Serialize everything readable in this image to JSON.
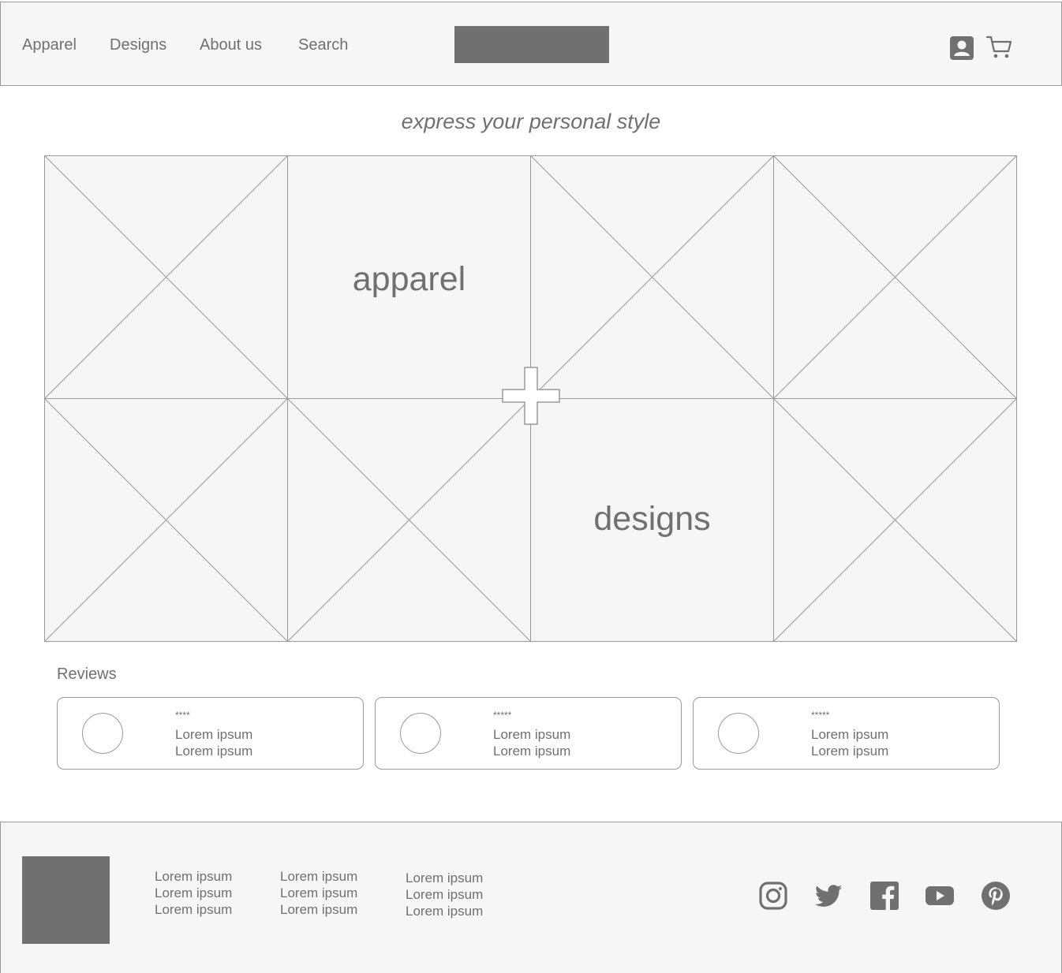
{
  "header": {
    "nav": [
      "Apparel",
      "Designs",
      "About us",
      "Search"
    ],
    "logo": "logo-placeholder",
    "icons": [
      "account-icon",
      "cart-icon"
    ]
  },
  "tagline": "express your personal style",
  "grid": {
    "labels": {
      "apparel": "apparel",
      "designs": "designs"
    }
  },
  "reviews": {
    "heading": "Reviews",
    "items": [
      {
        "stars": "****",
        "line1": "Lorem ipsum",
        "line2": "Lorem ipsum"
      },
      {
        "stars": "*****",
        "line1": "Lorem ipsum",
        "line2": "Lorem ipsum"
      },
      {
        "stars": "*****",
        "line1": "Lorem ipsum",
        "line2": "Lorem ipsum"
      }
    ]
  },
  "footer": {
    "columns": [
      [
        "Lorem ipsum",
        "Lorem ipsum",
        "Lorem ipsum"
      ],
      [
        "Lorem ipsum",
        "Lorem ipsum",
        "Lorem ipsum"
      ],
      [
        "Lorem ipsum",
        "Lorem ipsum",
        "Lorem ipsum"
      ]
    ],
    "social": [
      "instagram-icon",
      "twitter-icon",
      "facebook-icon",
      "youtube-icon",
      "pinterest-icon"
    ]
  },
  "colors": {
    "placeholder": "#707070",
    "background": "#f6f6f6",
    "border": "#9a9a9a"
  }
}
